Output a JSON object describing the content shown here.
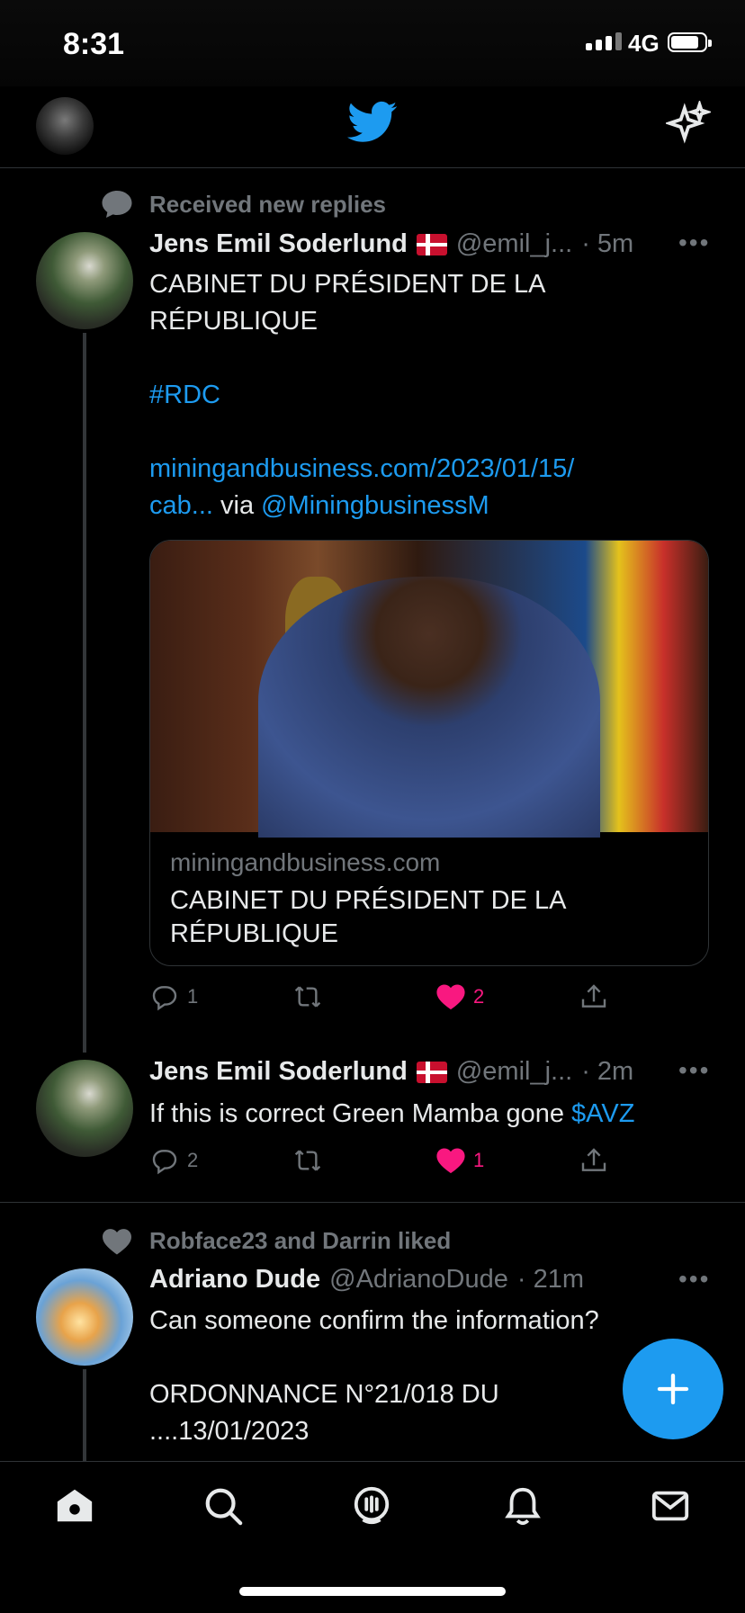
{
  "status_bar": {
    "time": "8:31",
    "network": "4G"
  },
  "feed": {
    "context_1": "Received new replies",
    "tweet_1": {
      "name": "Jens Emil Soderlund",
      "handle": "@emil_j...",
      "time": "· 5m",
      "line1": "CABINET DU PRÉSIDENT DE LA",
      "line2": "RÉPUBLIQUE",
      "hashtag": "#RDC",
      "url1": "miningandbusiness.com/2023/01/15/",
      "url2": "cab...",
      "via": "via",
      "mention": "@MiningbusinessM",
      "card": {
        "domain": "miningandbusiness.com",
        "title1": "CABINET DU PRÉSIDENT DE LA",
        "title2": "RÉPUBLIQUE"
      },
      "replies": "1",
      "likes": "2"
    },
    "tweet_2": {
      "name": "Jens Emil Soderlund",
      "handle": "@emil_j...",
      "time": "· 2m",
      "text": "If this is correct Green Mamba gone",
      "cashtag": "$AVZ",
      "replies": "2",
      "likes": "1"
    },
    "context_2": "Robface23 and Darrin liked",
    "tweet_3": {
      "name": "Adriano Dude",
      "handle": "@AdrianoDude",
      "time": "· 21m",
      "line1": "Can someone confirm the information?",
      "line2": "ORDONNANCE N°21/018 DU",
      "line3": "....13/01/2023"
    }
  },
  "colors": {
    "accent": "#1d9bf0",
    "like": "#f91880",
    "background": "#000000",
    "muted": "#71767b"
  },
  "icons": [
    "twitter-bird-icon",
    "sparkle-icon",
    "reply-icon",
    "retweet-icon",
    "heart-icon",
    "share-icon",
    "home-icon",
    "search-icon",
    "spaces-icon",
    "bell-icon",
    "mail-icon",
    "plus-icon"
  ]
}
